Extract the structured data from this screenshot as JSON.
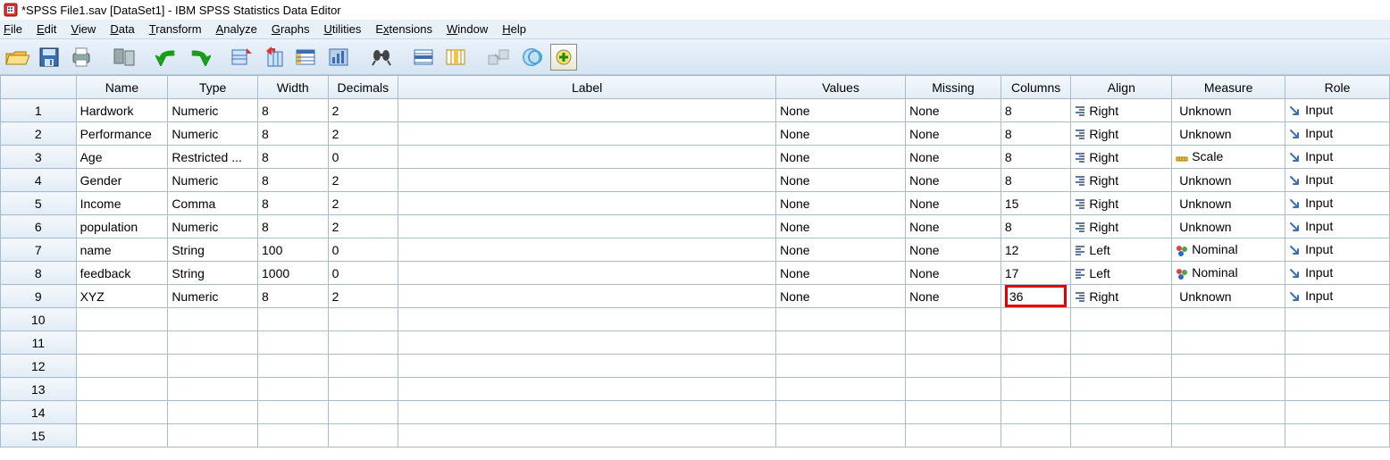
{
  "window": {
    "title": "*SPSS File1.sav [DataSet1] - IBM SPSS Statistics Data Editor"
  },
  "menu": {
    "file": "File",
    "edit": "Edit",
    "view": "View",
    "data": "Data",
    "transform": "Transform",
    "analyze": "Analyze",
    "graphs": "Graphs",
    "utilities": "Utilities",
    "extensions": "Extensions",
    "window": "Window",
    "help": "Help"
  },
  "columns": {
    "name": "Name",
    "type": "Type",
    "width": "Width",
    "decimals": "Decimals",
    "label": "Label",
    "values": "Values",
    "missing": "Missing",
    "columns": "Columns",
    "align": "Align",
    "measure": "Measure",
    "role": "Role"
  },
  "rows": [
    {
      "n": "1",
      "name": "Hardwork",
      "type": "Numeric",
      "width": "8",
      "decimals": "2",
      "label": "",
      "values": "None",
      "missing": "None",
      "columns": "8",
      "align": "Right",
      "measure": "Unknown",
      "role": "Input",
      "alignIcon": "right",
      "measureIcon": "unknown",
      "roleIcon": "input"
    },
    {
      "n": "2",
      "name": "Performance",
      "type": "Numeric",
      "width": "8",
      "decimals": "2",
      "label": "",
      "values": "None",
      "missing": "None",
      "columns": "8",
      "align": "Right",
      "measure": "Unknown",
      "role": "Input",
      "alignIcon": "right",
      "measureIcon": "unknown",
      "roleIcon": "input"
    },
    {
      "n": "3",
      "name": "Age",
      "type": "Restricted ...",
      "width": "8",
      "decimals": "0",
      "label": "",
      "values": "None",
      "missing": "None",
      "columns": "8",
      "align": "Right",
      "measure": "Scale",
      "role": "Input",
      "alignIcon": "right",
      "measureIcon": "scale",
      "roleIcon": "input"
    },
    {
      "n": "4",
      "name": "Gender",
      "type": "Numeric",
      "width": "8",
      "decimals": "2",
      "label": "",
      "values": "None",
      "missing": "None",
      "columns": "8",
      "align": "Right",
      "measure": "Unknown",
      "role": "Input",
      "alignIcon": "right",
      "measureIcon": "unknown",
      "roleIcon": "input"
    },
    {
      "n": "5",
      "name": "Income",
      "type": "Comma",
      "width": "8",
      "decimals": "2",
      "label": "",
      "values": "None",
      "missing": "None",
      "columns": "15",
      "align": "Right",
      "measure": "Unknown",
      "role": "Input",
      "alignIcon": "right",
      "measureIcon": "unknown",
      "roleIcon": "input"
    },
    {
      "n": "6",
      "name": "population",
      "type": "Numeric",
      "width": "8",
      "decimals": "2",
      "label": "",
      "values": "None",
      "missing": "None",
      "columns": "8",
      "align": "Right",
      "measure": "Unknown",
      "role": "Input",
      "alignIcon": "right",
      "measureIcon": "unknown",
      "roleIcon": "input"
    },
    {
      "n": "7",
      "name": "name",
      "type": "String",
      "width": "100",
      "decimals": "0",
      "label": "",
      "values": "None",
      "missing": "None",
      "columns": "12",
      "align": "Left",
      "measure": "Nominal",
      "role": "Input",
      "alignIcon": "left",
      "measureIcon": "nominal",
      "roleIcon": "input"
    },
    {
      "n": "8",
      "name": "feedback",
      "type": "String",
      "width": "1000",
      "decimals": "0",
      "label": "",
      "values": "None",
      "missing": "None",
      "columns": "17",
      "align": "Left",
      "measure": "Nominal",
      "role": "Input",
      "alignIcon": "left",
      "measureIcon": "nominal",
      "roleIcon": "input"
    },
    {
      "n": "9",
      "name": "XYZ",
      "type": "Numeric",
      "width": "8",
      "decimals": "2",
      "label": "",
      "values": "None",
      "missing": "None",
      "columns": "36",
      "align": "Right",
      "measure": "Unknown",
      "role": "Input",
      "alignIcon": "right",
      "measureIcon": "unknown",
      "roleIcon": "input",
      "highlightColumns": true
    }
  ],
  "emptyRows": [
    "10",
    "11",
    "12",
    "13",
    "14",
    "15"
  ]
}
